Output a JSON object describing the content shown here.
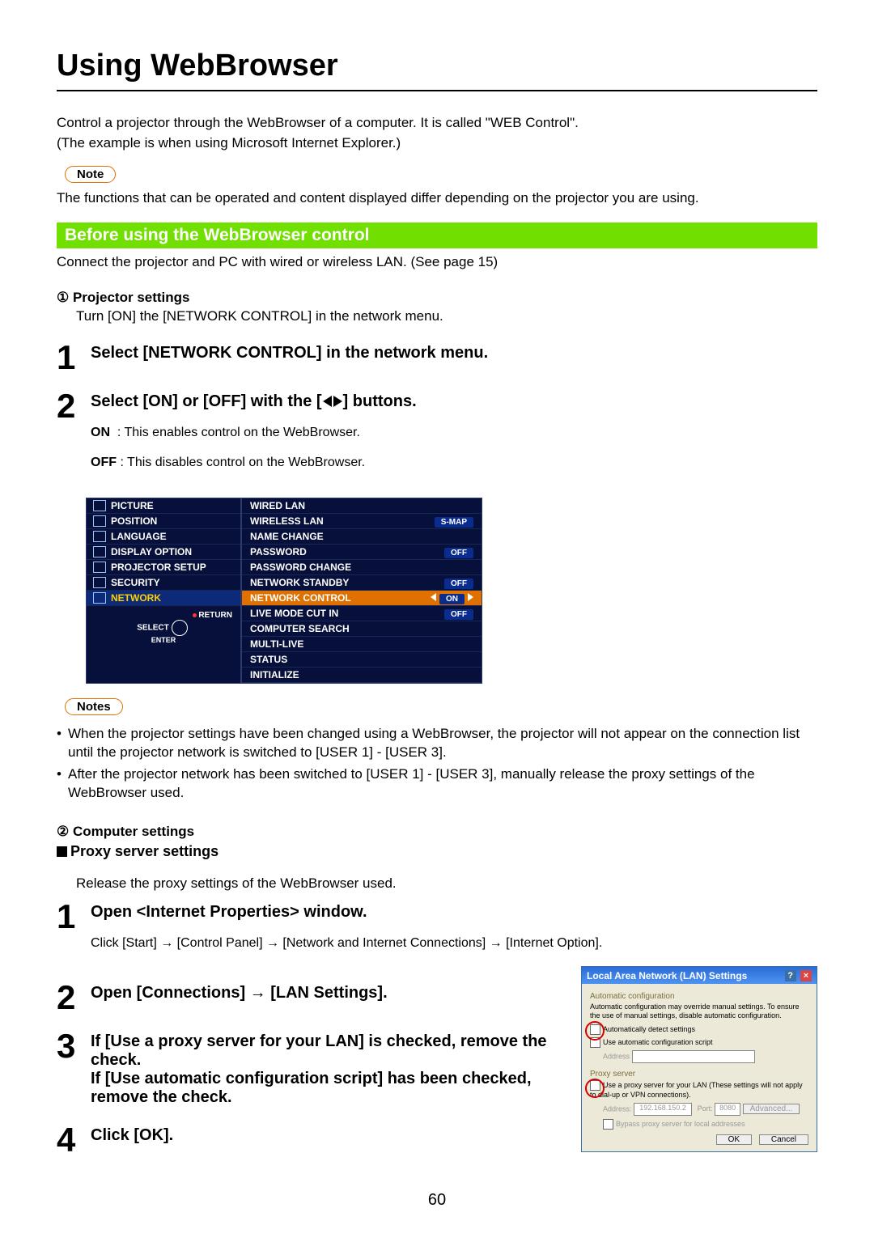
{
  "title": "Using WebBrowser",
  "intro1": "Control a projector through the WebBrowser of a computer. It is called \"WEB Control\".",
  "intro2": "(The example is when using Microsoft Internet Explorer.)",
  "note_label": "Note",
  "notes_label": "Notes",
  "note1": "The functions that can be operated and content displayed differ depending on the projector you are using.",
  "section_before": "Before using the WebBrowser control",
  "before_text": "Connect the projector and PC with wired or wireless LAN. (See page 15)",
  "proj_settings_heading": "① Projector settings",
  "proj_settings_text": "Turn [ON] the [NETWORK CONTROL] in the network menu.",
  "step1_title": "Select [NETWORK CONTROL] in the network menu.",
  "step2_title_a": "Select [ON] or [OFF] with the [",
  "step2_title_b": "] buttons.",
  "step2_on_label": "ON",
  "step2_on_text": ": This enables control on the WebBrowser.",
  "step2_off_label": "OFF",
  "step2_off_text": ": This disables control on the WebBrowser.",
  "proj_left_items": [
    "PICTURE",
    "POSITION",
    "LANGUAGE",
    "DISPLAY OPTION",
    "PROJECTOR SETUP",
    "SECURITY",
    "NETWORK"
  ],
  "pm_return": "RETURN",
  "pm_select": "SELECT",
  "pm_enter": "ENTER",
  "proj_right": [
    {
      "label": "WIRED LAN",
      "val": ""
    },
    {
      "label": "WIRELESS LAN",
      "val": "S-MAP"
    },
    {
      "label": "NAME CHANGE",
      "val": ""
    },
    {
      "label": "PASSWORD",
      "val": "OFF"
    },
    {
      "label": "PASSWORD CHANGE",
      "val": ""
    },
    {
      "label": "NETWORK STANDBY",
      "val": "OFF"
    },
    {
      "label": "NETWORK CONTROL",
      "val": "ON",
      "sel": true
    },
    {
      "label": "LIVE MODE CUT IN",
      "val": "OFF"
    },
    {
      "label": "COMPUTER SEARCH",
      "val": ""
    },
    {
      "label": "MULTI-LIVE",
      "val": ""
    },
    {
      "label": "STATUS",
      "val": ""
    },
    {
      "label": "INITIALIZE",
      "val": ""
    }
  ],
  "notes_list": [
    "When the projector settings have been changed using a WebBrowser, the projector will not appear on the connection list until the projector network is switched to [USER 1] - [USER 3].",
    "After the projector network has been switched to [USER 1] - [USER 3], manually release the proxy settings of the WebBrowser used."
  ],
  "comp_settings_heading": "② Computer settings",
  "proxy_heading": "Proxy server settings",
  "proxy_text": "Release the proxy settings of the WebBrowser used.",
  "pstep1_title": "Open <Internet Properties> window.",
  "pstep1_text": "Click [Start] → [Control Panel] → [Network and Internet Connections] → [Internet Option].",
  "pstep2_title": "Open [Connections] → [LAN Settings].",
  "pstep3_title": "If [Use a proxy server for your LAN] is checked, remove the check.\nIf [Use automatic configuration script] has been checked, remove the check.",
  "pstep4_title": "Click [OK].",
  "lan": {
    "title": "Local Area Network (LAN) Settings",
    "auto_conf": "Automatic configuration",
    "auto_text": "Automatic configuration may override manual settings. To ensure the use of manual settings, disable automatic configuration.",
    "auto_detect": "Automatically detect settings",
    "use_script": "Use automatic configuration script",
    "address": "Address",
    "proxy_server": "Proxy server",
    "proxy_text": "Use a proxy server for your LAN (These settings will not apply to dial-up or VPN connections).",
    "addr2": "Address:",
    "addr2_v": "192.168.150.2",
    "port": "Port:",
    "port_v": "8080",
    "advanced": "Advanced...",
    "bypass": "Bypass proxy server for local addresses",
    "ok": "OK",
    "cancel": "Cancel"
  },
  "page_number": "60"
}
